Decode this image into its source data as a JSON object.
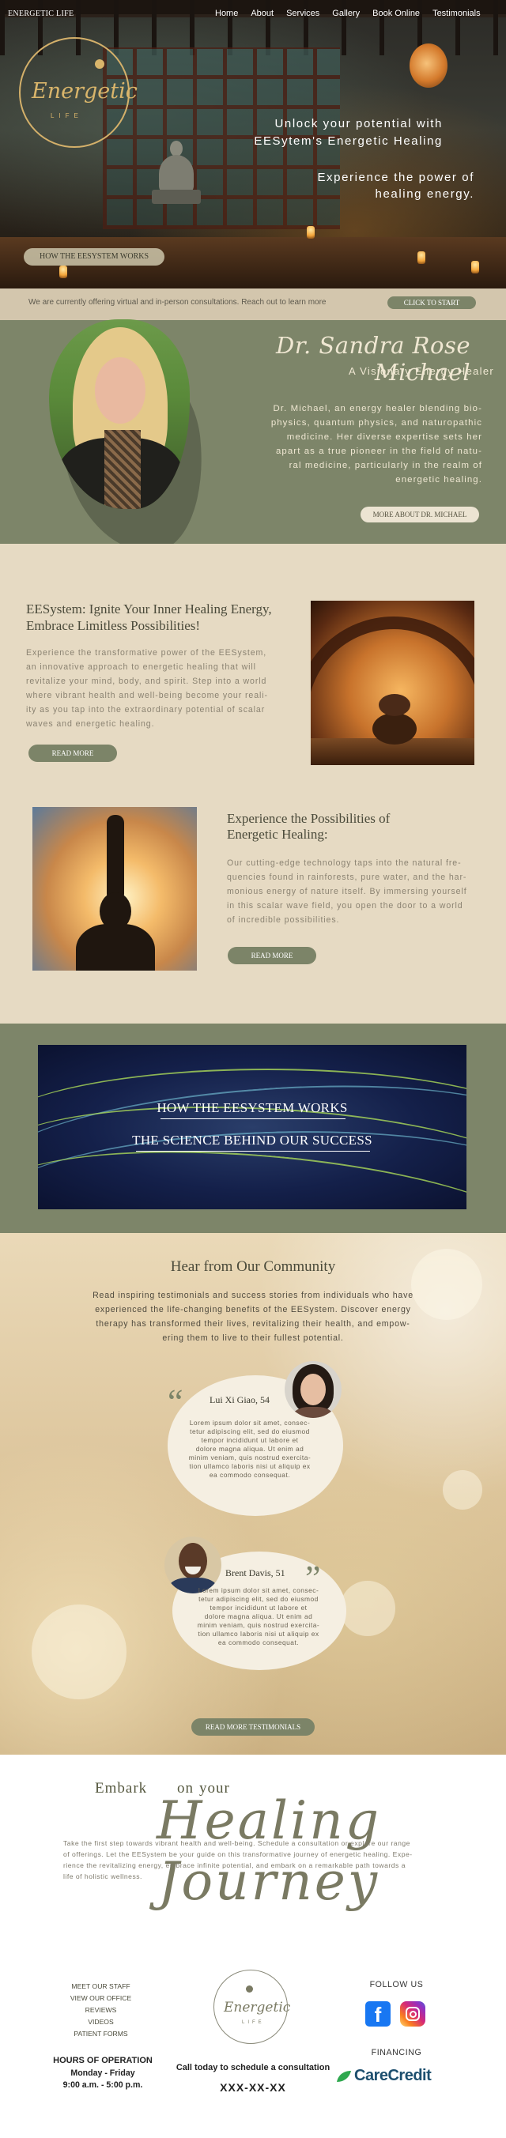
{
  "nav": {
    "brand": "ENERGETIC LIFE",
    "items": [
      "Home",
      "About",
      "Services",
      "Gallery",
      "Book Online",
      "Testimonials"
    ]
  },
  "hero": {
    "logo_word": "Energetic",
    "logo_sub": "LIFE",
    "line1": "Unlock your potential with",
    "line2": "EESytem's Energetic Healing",
    "line3": "Experience the power of",
    "line4": "healing energy.",
    "button": "HOW THE EESYSTEM WORKS"
  },
  "consult": {
    "text": "We are currently offering virtual and in-person consultations. Reach out to learn more",
    "button": "CLICK TO START"
  },
  "about": {
    "name": "Dr. Sandra Rose Michael",
    "subtitle": "A Visionary Energy Healer",
    "bio_lines": [
      "Dr. Michael, an energy healer blending bio-",
      "physics, quantum physics, and naturopathic",
      "medicine. Her diverse expertise sets her",
      "apart as a true pioneer in the field of natu-",
      "ral medicine, particularly in the realm of",
      "energetic healing."
    ],
    "button": "MORE ABOUT DR. MICHAEL"
  },
  "eesystem": {
    "title_lines": [
      "EESystem: Ignite Your Inner Healing Energy,",
      "Embrace Limitless Possibilities!"
    ],
    "body_lines": [
      "Experience the transformative power of the EESystem,",
      "an innovative approach to energetic healing that will",
      "revitalize your mind, body, and spirit. Step into a world",
      "where vibrant health and well-being become your reali-",
      "ity as you tap into the extraordinary potential of scalar",
      "waves and energetic healing."
    ],
    "button": "READ MORE"
  },
  "experience": {
    "title_lines": [
      "Experience the Possibilities of",
      "Energetic Healing:"
    ],
    "body_lines": [
      "Our cutting-edge technology taps into the natural fre-",
      "quencies found in rainforests, pure water, and the har-",
      "monious energy of nature itself. By immersing yourself",
      "in this scalar wave field, you open the door to a world",
      "of incredible possibilities."
    ],
    "button": "READ MORE"
  },
  "science": {
    "link1": "HOW THE EESYSTEM WORKS",
    "link2": "THE SCIENCE BEHIND OUR SUCCESS"
  },
  "community": {
    "title": "Hear from Our Community",
    "body_lines": [
      "Read inspiring testimonials and success stories from individuals who have",
      "experienced the life-changing benefits of the EESystem. Discover energy",
      "therapy has transformed their lives, revitalizing their health, and empow-",
      "ering them to live to their fullest potential."
    ],
    "testimonials": [
      {
        "name": "Lui Xi Giao, 54",
        "lines": [
          "Lorem ipsum dolor sit amet, consec-",
          "tetur adipiscing elit, sed do eiusmod",
          "tempor incididunt ut labore et",
          "dolore magna aliqua. Ut enim ad",
          "minim veniam, quis nostrud exercita-",
          "tion ullamco laboris nisi ut aliquip ex",
          "ea commodo consequat."
        ]
      },
      {
        "name": "Brent Davis, 51",
        "lines": [
          "Lorem ipsum dolor sit amet, consec-",
          "tetur adipiscing elit, sed do eiusmod",
          "tempor incididunt ut labore et",
          "dolore magna aliqua. Ut enim ad",
          "minim veniam, quis nostrud exercita-",
          "tion ullamco laboris nisi ut aliquip ex",
          "ea commodo consequat."
        ]
      }
    ],
    "button": "READ MORE TESTIMONIALS"
  },
  "embark": {
    "word1": "Embark",
    "word2": "on",
    "word3": "your",
    "script": "Healing Journey",
    "body_lines": [
      "Take the first step towards vibrant health and well-being. Schedule a consultation or explore our range",
      "of offerings. Let the EESystem be your guide on this transformative journey of energetic healing. Expe-",
      "rience the revitalizing energy, embrace infinite potential, and embark on a remarkable path towards a",
      "life of holistic wellness."
    ]
  },
  "footer": {
    "links": [
      "MEET OUR STAFF",
      "VIEW OUR OFFICE",
      "REVIEWS",
      "VIDEOS",
      "PATIENT FORMS"
    ],
    "hours_title": "HOURS OF OPERATION",
    "hours_days": "Monday - Friday",
    "hours_time": "9:00 a.m. - 5:00 p.m.",
    "logo_word": "Energetic",
    "logo_sub": "LIFE",
    "call": "Call today to schedule a consultation",
    "phone": "XXX-XX-XX",
    "follow": "FOLLOW US",
    "facebook_glyph": "f",
    "financing": "FINANCING",
    "carecredit": "CareCredit",
    "colors": {
      "accent": "#7c8468",
      "facebook": "#1877f2",
      "carecredit": "#1d4f6e"
    }
  }
}
